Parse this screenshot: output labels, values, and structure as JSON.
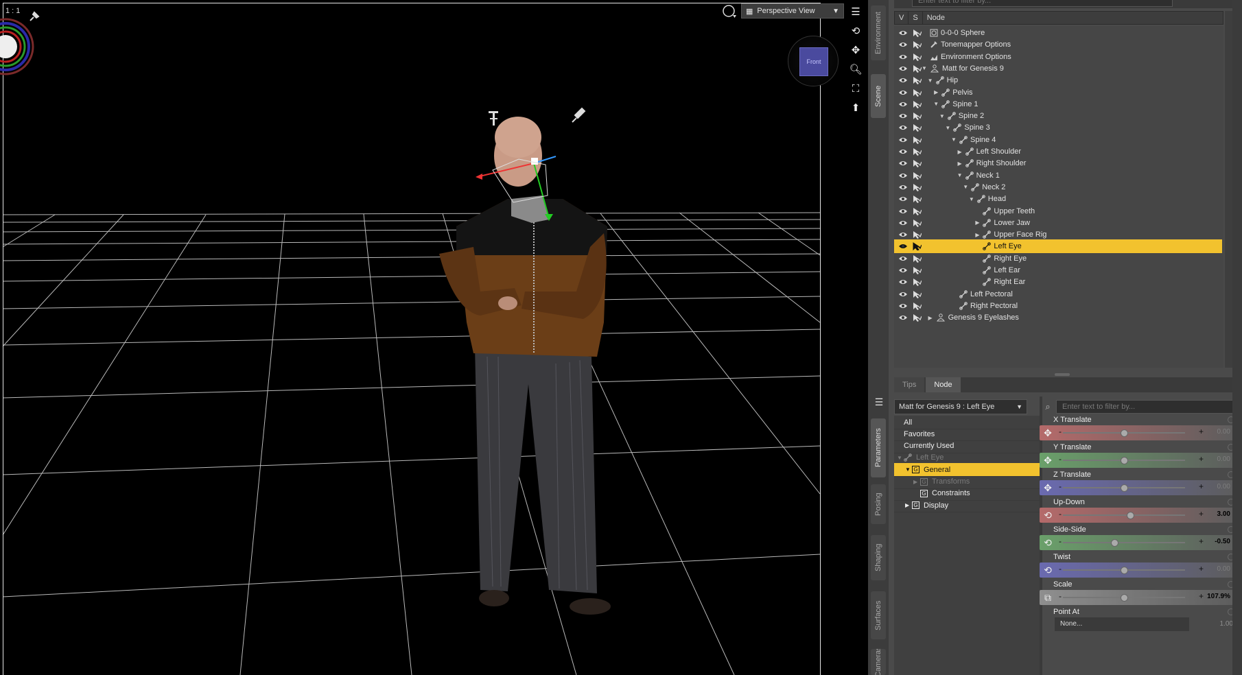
{
  "viewport": {
    "ratio_label": "1 : 1",
    "view_dropdown": "Perspective View",
    "nav_cube_label": "Front",
    "tools": [
      "menu-icon",
      "orbit-icon",
      "pan-icon",
      "zoom-icon",
      "frame-icon",
      "home-icon"
    ]
  },
  "side_tabs": [
    "Environment",
    "Scene",
    "Parameters",
    "Posing",
    "Shaping",
    "Surfaces",
    "Cameras"
  ],
  "scene": {
    "filter_placeholder": "Enter text to filter by...",
    "columns": [
      "V",
      "S",
      "Node"
    ],
    "rows": [
      {
        "label": "0-0-0 Sphere",
        "depth": 0,
        "twisty": "",
        "icon": "sphere"
      },
      {
        "label": "Tonemapper Options",
        "depth": 0,
        "twisty": "",
        "icon": "tonemap"
      },
      {
        "label": "Environment Options",
        "depth": 0,
        "twisty": "",
        "icon": "env"
      },
      {
        "label": "Matt for Genesis 9",
        "depth": 0,
        "twisty": "▼",
        "icon": "figure"
      },
      {
        "label": "Hip",
        "depth": 1,
        "twisty": "▼",
        "icon": "bone"
      },
      {
        "label": "Pelvis",
        "depth": 2,
        "twisty": "▶",
        "icon": "bone"
      },
      {
        "label": "Spine 1",
        "depth": 2,
        "twisty": "▼",
        "icon": "bone"
      },
      {
        "label": "Spine 2",
        "depth": 3,
        "twisty": "▼",
        "icon": "bone"
      },
      {
        "label": "Spine 3",
        "depth": 4,
        "twisty": "▼",
        "icon": "bone"
      },
      {
        "label": "Spine 4",
        "depth": 5,
        "twisty": "▼",
        "icon": "bone"
      },
      {
        "label": "Left Shoulder",
        "depth": 6,
        "twisty": "▶",
        "icon": "bone"
      },
      {
        "label": "Right Shoulder",
        "depth": 6,
        "twisty": "▶",
        "icon": "bone"
      },
      {
        "label": "Neck 1",
        "depth": 6,
        "twisty": "▼",
        "icon": "bone"
      },
      {
        "label": "Neck 2",
        "depth": 7,
        "twisty": "▼",
        "icon": "bone"
      },
      {
        "label": "Head",
        "depth": 8,
        "twisty": "▼",
        "icon": "bone"
      },
      {
        "label": "Upper Teeth",
        "depth": 9,
        "twisty": "",
        "icon": "bone"
      },
      {
        "label": "Lower Jaw",
        "depth": 9,
        "twisty": "▶",
        "icon": "bone"
      },
      {
        "label": "Upper Face Rig",
        "depth": 9,
        "twisty": "▶",
        "icon": "bone"
      },
      {
        "label": "Left Eye",
        "depth": 9,
        "twisty": "",
        "icon": "bone",
        "selected": true
      },
      {
        "label": "Right Eye",
        "depth": 9,
        "twisty": "",
        "icon": "bone"
      },
      {
        "label": "Left Ear",
        "depth": 9,
        "twisty": "",
        "icon": "bone"
      },
      {
        "label": "Right Ear",
        "depth": 9,
        "twisty": "",
        "icon": "bone"
      },
      {
        "label": "Left Pectoral",
        "depth": 5,
        "twisty": "",
        "icon": "bone"
      },
      {
        "label": "Right Pectoral",
        "depth": 5,
        "twisty": "",
        "icon": "bone"
      },
      {
        "label": "Genesis 9 Eyelashes",
        "depth": 1,
        "twisty": "▶",
        "icon": "figure"
      }
    ]
  },
  "lower_tabs": [
    "Tips",
    "Node"
  ],
  "parameters": {
    "node_dropdown": "Matt for Genesis 9 : Left Eye",
    "filter_placeholder": "Enter text to filter by...",
    "categories": [
      {
        "label": "All",
        "indent": 0,
        "twisty": "",
        "group": false,
        "dim": false
      },
      {
        "label": "Favorites",
        "indent": 0,
        "twisty": "",
        "group": false,
        "dim": false
      },
      {
        "label": "Currently Used",
        "indent": 0,
        "twisty": "",
        "group": false,
        "dim": false
      },
      {
        "label": "Left Eye",
        "indent": 0,
        "twisty": "▼",
        "group": false,
        "dim": true,
        "bone": true
      },
      {
        "label": "General",
        "indent": 1,
        "twisty": "▼",
        "group": true,
        "dim": false,
        "selected": true
      },
      {
        "label": "Transforms",
        "indent": 2,
        "twisty": "▶",
        "group": true,
        "dim": true
      },
      {
        "label": "Constraints",
        "indent": 2,
        "twisty": "",
        "group": true,
        "dim": false
      },
      {
        "label": "Display",
        "indent": 1,
        "twisty": "▶",
        "group": true,
        "dim": false
      }
    ],
    "sliders": [
      {
        "name": "X Translate",
        "value": "0.00",
        "color": "#b56a6a",
        "icon": "move-icon",
        "knob": 0.5,
        "changed": false
      },
      {
        "name": "Y Translate",
        "value": "0.00",
        "color": "#6aa06a",
        "icon": "move-icon",
        "knob": 0.5,
        "changed": false
      },
      {
        "name": "Z Translate",
        "value": "0.00",
        "color": "#6a6ab0",
        "icon": "move-icon",
        "knob": 0.5,
        "changed": false
      },
      {
        "name": "Up-Down",
        "value": "3.00",
        "color": "#b56a6a",
        "icon": "rotate-icon",
        "knob": 0.55,
        "changed": true
      },
      {
        "name": "Side-Side",
        "value": "-0.50",
        "color": "#6aa06a",
        "icon": "rotate-icon",
        "knob": 0.42,
        "changed": true
      },
      {
        "name": "Twist",
        "value": "0.00",
        "color": "#6a6ab0",
        "icon": "rotate-icon",
        "knob": 0.5,
        "changed": false
      },
      {
        "name": "Scale",
        "value": "107.9%",
        "color": "#8f8f8f",
        "icon": "scale-icon",
        "knob": 0.5,
        "changed": true
      }
    ],
    "point_at": {
      "name": "Point At",
      "button": "None...",
      "value": "1.00"
    }
  }
}
